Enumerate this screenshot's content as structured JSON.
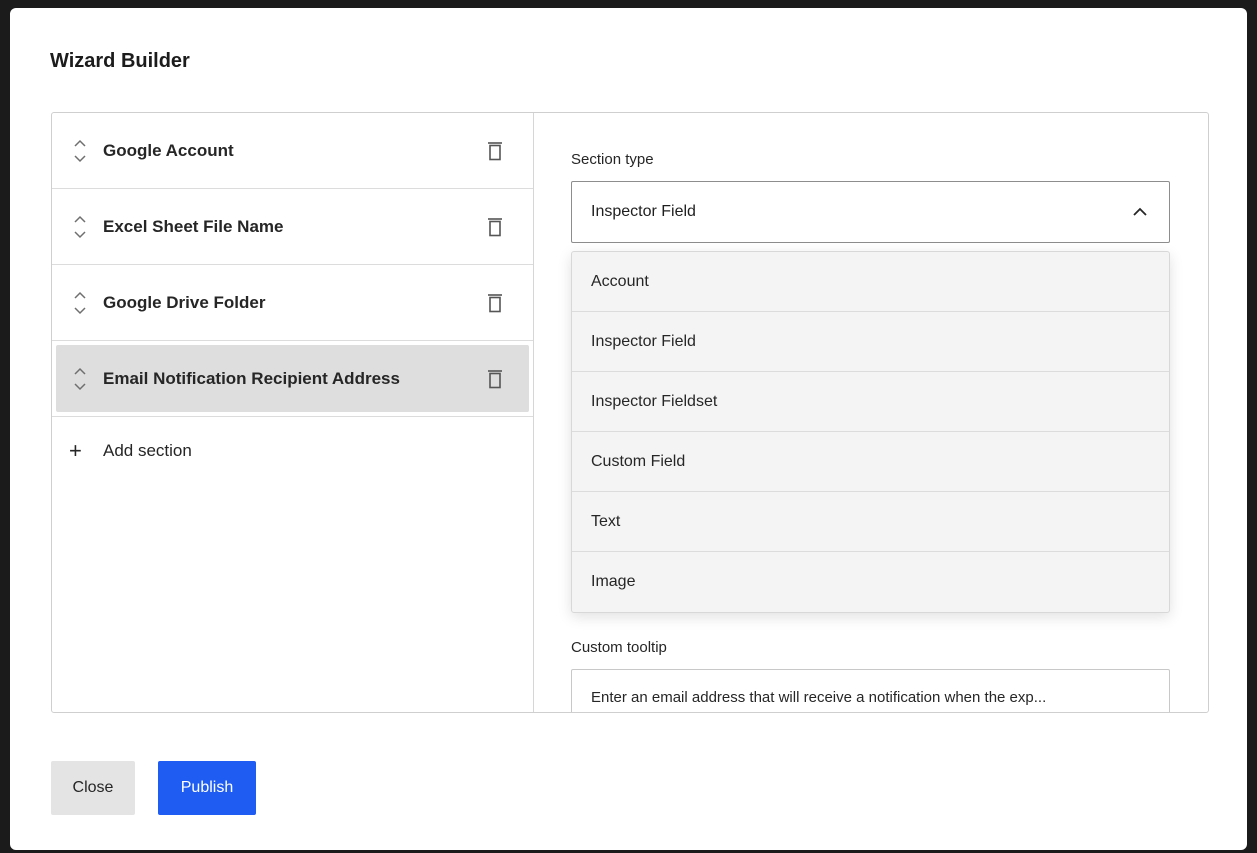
{
  "dialog": {
    "title": "Wizard Builder"
  },
  "sections": [
    {
      "label": "Google Account",
      "selected": false
    },
    {
      "label": "Excel Sheet File Name",
      "selected": false
    },
    {
      "label": "Google Drive Folder",
      "selected": false
    },
    {
      "label": "Email Notification Recipient Address",
      "selected": true
    }
  ],
  "add_section": {
    "icon": "plus-icon",
    "label": "Add section"
  },
  "section_type": {
    "label": "Section type",
    "value": "Inspector Field",
    "expanded": true,
    "options": [
      "Account",
      "Inspector Field",
      "Inspector Fieldset",
      "Custom Field",
      "Text",
      "Image"
    ]
  },
  "custom_tooltip": {
    "label": "Custom tooltip",
    "value": "Enter an email address that will receive a notification when the exp..."
  },
  "footer": {
    "close_label": "Close",
    "publish_label": "Publish"
  },
  "colors": {
    "primary": "#1f5cf2",
    "selected_row": "#dedede",
    "dropdown_bg": "#f4f4f4"
  }
}
